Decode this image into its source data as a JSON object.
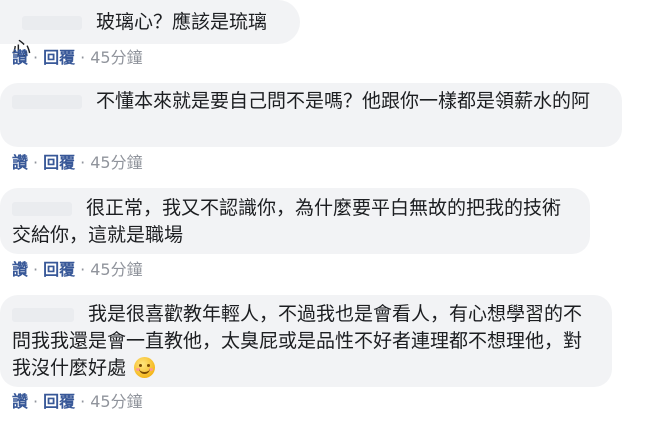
{
  "action_labels": {
    "like": "讚",
    "reply": "回覆"
  },
  "comments": [
    {
      "text": "玻璃心？應該是琉璃心",
      "time": "45分鐘"
    },
    {
      "text": "不懂本來就是要自己問不是嗎？他跟你一樣都是領薪水的阿",
      "time": "45分鐘"
    },
    {
      "text": "很正常，我又不認識你，為什麼要平白無故的把我的技術交給你，這就是職場",
      "time": "45分鐘"
    },
    {
      "text": "我是很喜歡教年輕人，不過我也是會看人，有心想學習的不問我我還是會一直教他，太臭屁或是品性不好者連理都不想理他，對我沒什麼好處",
      "time": "45分鐘",
      "emoji": "smiling-face-emoji"
    }
  ]
}
